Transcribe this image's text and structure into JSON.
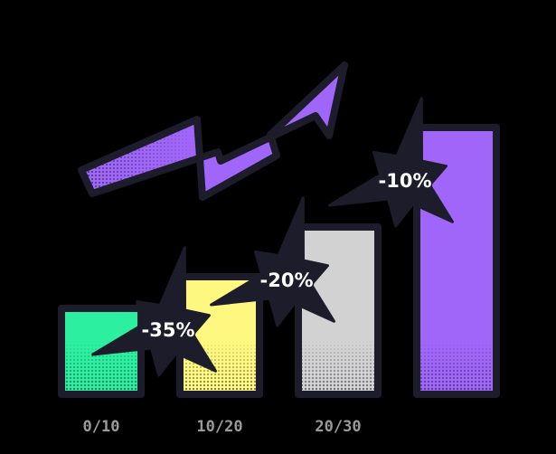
{
  "chart_data": {
    "type": "bar",
    "categories": [
      "0/10",
      "10/20",
      "20/30",
      ""
    ],
    "values": [
      38,
      52,
      74,
      118
    ],
    "ylim": [
      0,
      120
    ],
    "bar_colors": [
      "#2cf0a0",
      "#fff880",
      "#d2d2d2",
      "#a066fa"
    ],
    "badges": [
      "-35%",
      "-20%",
      "-10%"
    ],
    "grid": false,
    "legend": "none"
  },
  "colors": {
    "background": "#000000",
    "outline": "#1c1c2a",
    "arrow": "#a066fa",
    "badge": "#1c1c2a"
  },
  "icons": {
    "trend": "trend-up-arrow-icon"
  }
}
